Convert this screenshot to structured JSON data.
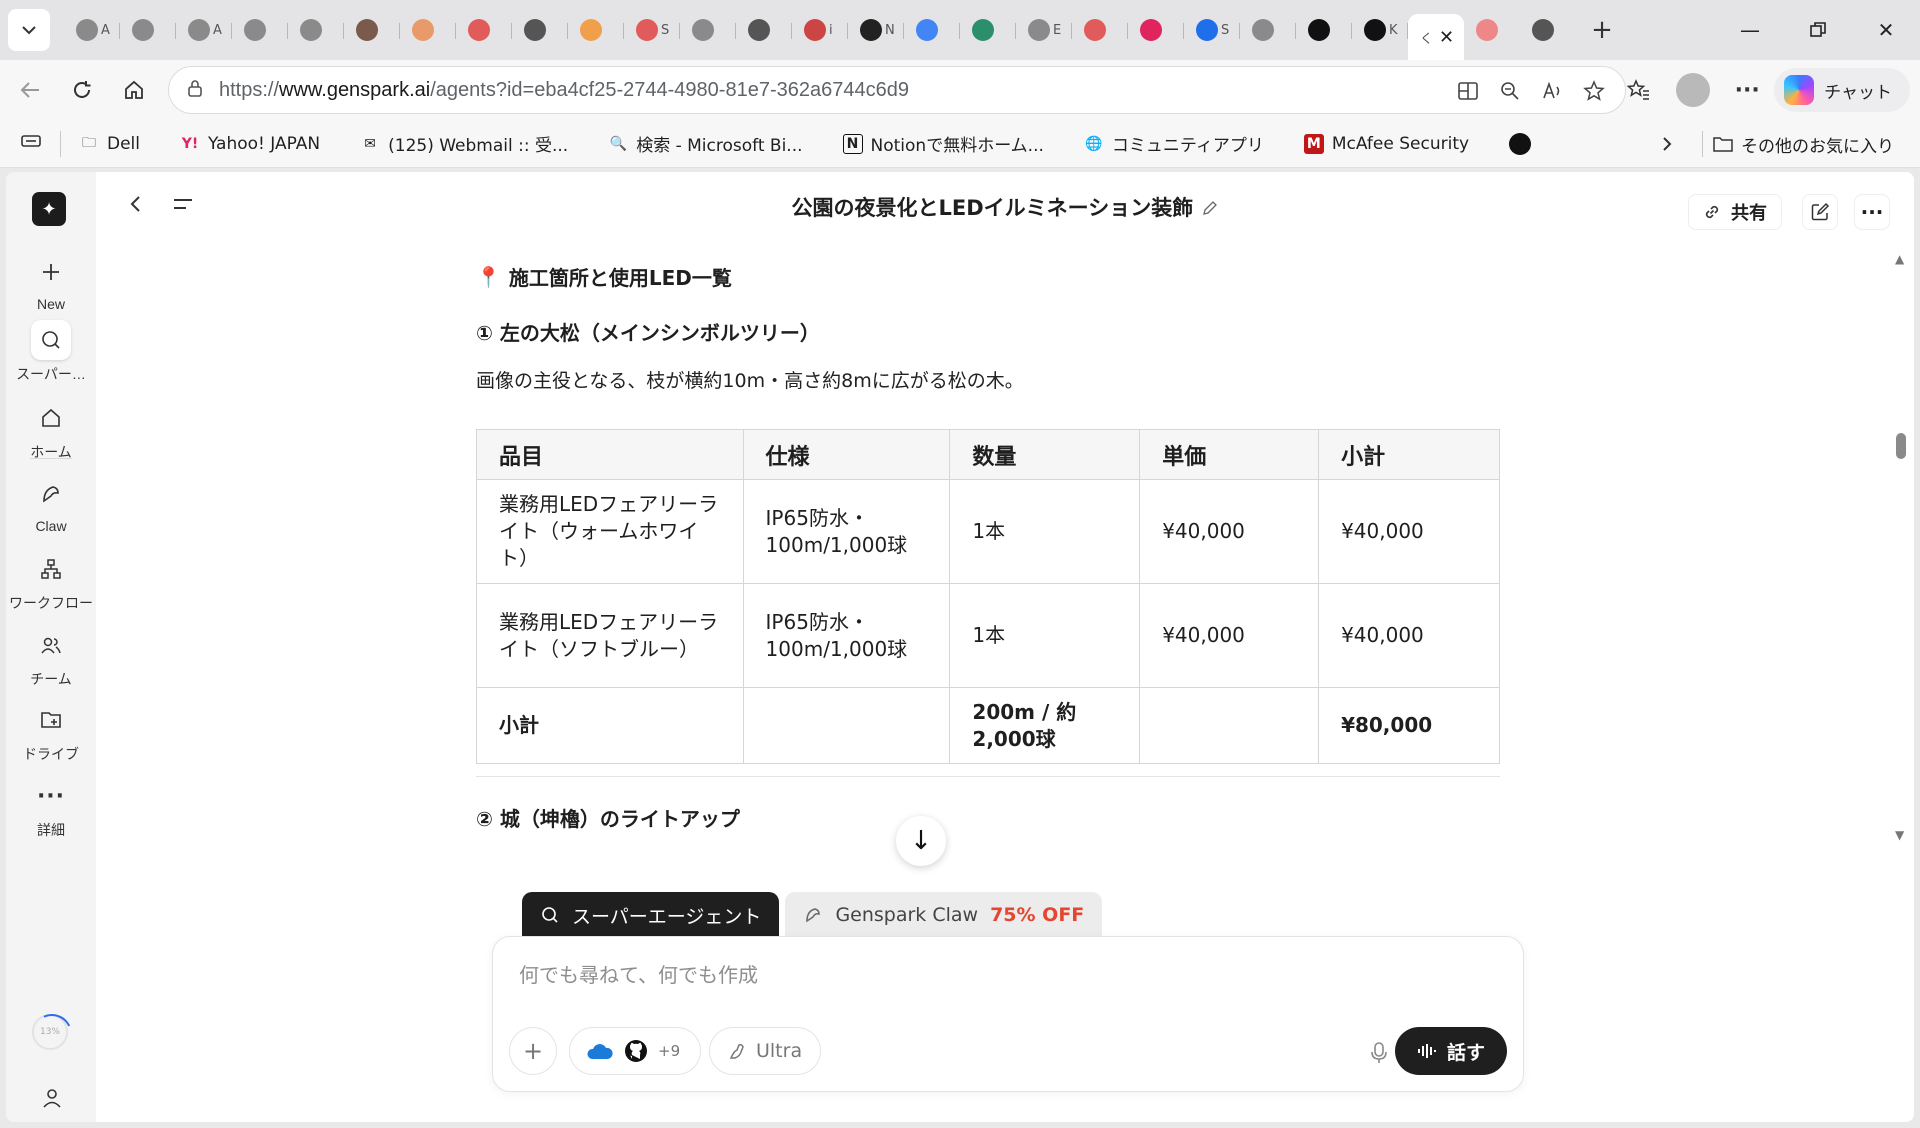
{
  "browser": {
    "tabs": [
      {
        "icon": "robot-icon",
        "color": "#8a8a8a",
        "char": "A"
      },
      {
        "icon": "robot-icon",
        "color": "#8a8a8a",
        "char": ""
      },
      {
        "icon": "robot-icon",
        "color": "#8a8a8a",
        "char": "A"
      },
      {
        "icon": "globe-icon",
        "color": "#8a8a8a",
        "char": ""
      },
      {
        "icon": "globe-icon",
        "color": "#8a8a8a",
        "char": ""
      },
      {
        "icon": "burst-icon",
        "color": "#7a5a4a",
        "char": ""
      },
      {
        "icon": "sunburst-icon",
        "color": "#e89a6b",
        "char": ""
      },
      {
        "icon": "apps-grid-icon",
        "color": "#e25b5b",
        "char": ""
      },
      {
        "icon": "square-icon",
        "color": "#555555",
        "char": ""
      },
      {
        "icon": "cloud-icon",
        "color": "#f0a04b",
        "char": ""
      },
      {
        "icon": "apps-grid-icon",
        "color": "#e25b5b",
        "char": "S"
      },
      {
        "icon": "globe-icon",
        "color": "#8a8a8a",
        "char": ""
      },
      {
        "icon": "xs-icon",
        "color": "#555555",
        "char": ""
      },
      {
        "icon": "dots-icon",
        "color": "#c44",
        "char": "i"
      },
      {
        "icon": "notion-icon",
        "color": "#222222",
        "char": "N"
      },
      {
        "icon": "google-icon",
        "color": "#4285f4",
        "char": ""
      },
      {
        "icon": "s-icon",
        "color": "#2b8f6b",
        "char": ""
      },
      {
        "icon": "globe-icon",
        "color": "#8a8a8a",
        "char": "E"
      },
      {
        "icon": "ab-icon",
        "color": "#e25b5b",
        "char": ""
      },
      {
        "icon": "bird-icon",
        "color": "#e0245e",
        "char": ""
      },
      {
        "icon": "bing-icon",
        "color": "#1f6feb",
        "char": "S"
      },
      {
        "icon": "globe-icon",
        "color": "#8a8a8a",
        "char": ""
      },
      {
        "icon": "xs-icon",
        "color": "#111111",
        "char": ""
      },
      {
        "icon": "robot-icon",
        "color": "#111111",
        "char": "K"
      }
    ],
    "active_tab_char": "く",
    "url_scheme": "https://",
    "url_host": "www.genspark.ai",
    "url_path": "/agents?id=eba4cf25-2744-4980-81e7-362a6744c6d9",
    "copilot_label": "チャット",
    "bookmarks": [
      {
        "icon": "folder-icon",
        "label": "Dell"
      },
      {
        "icon": "yahoo-icon",
        "label": "Yahoo! JAPAN"
      },
      {
        "icon": "webmail-icon",
        "label": "(125) Webmail :: 受..."
      },
      {
        "icon": "search-icon",
        "label": "検索 - Microsoft Bi..."
      },
      {
        "icon": "notion-icon",
        "label": "Notionで無料ホーム..."
      },
      {
        "icon": "globe-icon",
        "label": "コミュニティアプリ"
      },
      {
        "icon": "mcafee-icon",
        "label": "McAfee Security"
      }
    ],
    "other_favorites": "その他のお気に入り"
  },
  "sidebar": {
    "items": [
      {
        "name": "new",
        "icon": "plus-icon",
        "label": "New"
      },
      {
        "name": "super-agent",
        "icon": "super-agent-icon",
        "label": "スーパー…"
      },
      {
        "name": "home",
        "icon": "home-icon",
        "label": "ホーム"
      },
      {
        "name": "claw",
        "icon": "claw-icon",
        "label": "Claw"
      },
      {
        "name": "workflow",
        "icon": "workflow-icon",
        "label": "ワークフロー"
      },
      {
        "name": "team",
        "icon": "team-icon",
        "label": "チーム"
      },
      {
        "name": "drive",
        "icon": "drive-icon",
        "label": "ドライブ"
      },
      {
        "name": "more",
        "icon": "more-icon",
        "label": "詳細"
      }
    ],
    "progress": "13%"
  },
  "header": {
    "title": "公園の夜景化とLEDイルミネーション装飾",
    "share_label": "共有"
  },
  "document": {
    "section_heading": "施工箇所と使用LED一覧",
    "sub_heading_1": "① 左の大松（メインシンボルツリー）",
    "paragraph_1": "画像の主役となる、枝が横約10m・高さ約8mに広がる松の木。",
    "table": {
      "headers": [
        "品目",
        "仕様",
        "数量",
        "単価",
        "小計"
      ],
      "rows": [
        [
          "業務用LEDフェアリーライト（ウォームホワイト）",
          "IP65防水・100m/1,000球",
          "1本",
          "¥40,000",
          "¥40,000"
        ],
        [
          "業務用LEDフェアリーライト（ソフトブルー）",
          "IP65防水・100m/1,000球",
          "1本",
          "¥40,000",
          "¥40,000"
        ]
      ],
      "total": [
        "小計",
        "",
        "200m / 約2,000球",
        "",
        "¥80,000"
      ]
    },
    "sub_heading_2": "② 城（坤櫓）のライトアップ"
  },
  "composer": {
    "tab_super_agent": "スーパーエージェント",
    "tab_claw": "Genspark Claw",
    "tab_claw_badge": "75% OFF",
    "placeholder": "何でも尋ねて、何でも作成",
    "connectors_more": "+9",
    "ultra_label": "Ultra",
    "talk_label": "話す"
  }
}
